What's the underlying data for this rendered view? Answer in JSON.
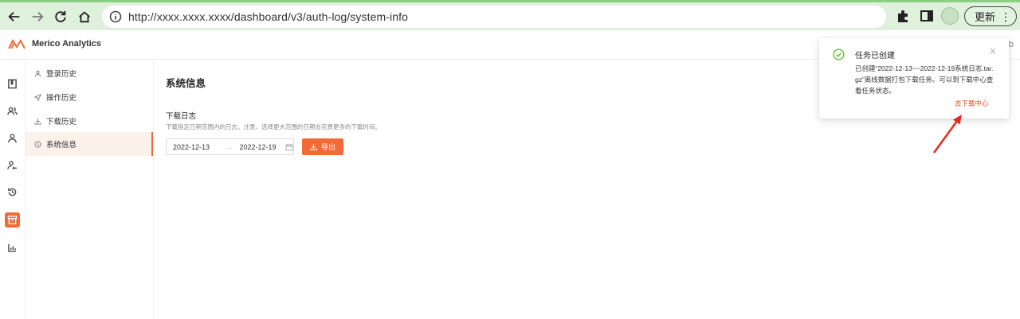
{
  "browser": {
    "url": "http://xxxx.xxxx.xxxx/dashboard/v3/auth-log/system-info",
    "update_label": "更新",
    "update_more": "⋮"
  },
  "header": {
    "brand_name": "Merico Analytics",
    "brand_color": "#f26a35",
    "trail": "b"
  },
  "sub_nav": {
    "items": [
      {
        "label": "登录历史",
        "icon": "user-icon"
      },
      {
        "label": "操作历史",
        "icon": "send-icon"
      },
      {
        "label": "下载历史",
        "icon": "download-icon"
      },
      {
        "label": "系统信息",
        "icon": "info-circle-icon",
        "active": true
      }
    ]
  },
  "main": {
    "page_title": "系统信息",
    "section_title": "下载日志",
    "section_desc": "下载指定日期范围内的日志。注意，选择更大范围的日期会花费更多的下载时间。",
    "date_start": "2022-12-13",
    "date_separator": "→",
    "date_end": "2022-12-19",
    "export_label": "导出"
  },
  "notification": {
    "title": "任务已创建",
    "body": "已创建“2022-12-13~~2022-12-19系统日志.tar.gz”离线数据打包下载任务。可以到下载中心查看任务状态。",
    "link_label": "去下载中心",
    "close_label": "X",
    "status_color": "#52c41a"
  }
}
